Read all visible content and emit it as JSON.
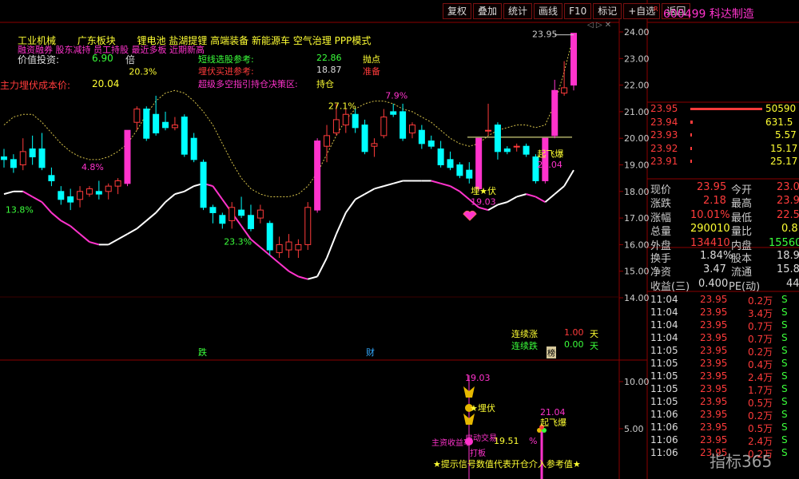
{
  "toolbar": {
    "buttons": [
      "复权",
      "叠加",
      "统计",
      "画线",
      "F10",
      "标记",
      "+自选",
      "返回"
    ],
    "icons": "◁ ▷ ✕"
  },
  "stock": {
    "badge": "R",
    "code_name": "600499 科达制造"
  },
  "overlay": {
    "sectors": [
      "工业机械",
      "广东板块",
      "锂电池",
      "盐湖提锂",
      "高端装备",
      "新能源车",
      "空气治理",
      "PPP模式"
    ],
    "line2": "融资融券  股东减持  员工持股  最近多板  近期新高",
    "value_label": "价值投资:",
    "value": "6.90",
    "value_unit": "倍",
    "cost_label": "主力埋伏成本价:",
    "cost": "20.04",
    "short_label": "短线选股参考:",
    "short_val": "22.86",
    "short_sig": "抛点",
    "ambush_label": "埋伏买进参考:",
    "ambush_val": "18.87",
    "ambush_sig": "准备",
    "super_label": "超级多空指引持仓决策区:",
    "super_sig": "持仓",
    "streak_up_label": "连续涨",
    "streak_up_val": "1.00",
    "streak_up_unit": "天",
    "streak_dn_label": "连续跌",
    "streak_dn_val": "0.00",
    "streak_dn_unit": "天",
    "markers": {
      "die": "跌",
      "cai": "财",
      "bang": "榜"
    }
  },
  "sub": {
    "price_top": "19.03",
    "maifu": "★埋伏",
    "jidong": "启动交易",
    "zhuli": "主资收益率",
    "pct_val": "19.51",
    "pct_sign": "%",
    "daban": "打板",
    "tip": "★提示信号数值代表开仓介入参考值★",
    "qifei_val": "21.04",
    "qifei": "起飞爆"
  },
  "orderbook": [
    {
      "price": "23.95",
      "vol": "50590",
      "bar": 1.0
    },
    {
      "price": "23.94",
      "vol": "631.5",
      "bar": 0.0
    },
    {
      "price": "23.93",
      "vol": "5.57",
      "bar": 0.0
    },
    {
      "price": "23.92",
      "vol": "15.17",
      "bar": 0.0
    },
    {
      "price": "23.91",
      "vol": "25.17",
      "bar": 0.0
    }
  ],
  "info": [
    [
      "现价",
      "23.95",
      "今开",
      "23.0"
    ],
    [
      "涨跌",
      "2.18",
      "最高",
      "23.9"
    ],
    [
      "涨幅",
      "10.01%",
      "最低",
      "22.5"
    ],
    [
      "总量",
      "290010",
      "量比",
      "0.8"
    ],
    [
      "外盘",
      "134410",
      "内盘",
      "15560"
    ]
  ],
  "fin": [
    [
      "换手",
      "1.84%",
      "股本",
      "18.9"
    ],
    [
      "净资",
      "3.47",
      "流通",
      "15.8"
    ],
    [
      "收益(三)",
      "0.400",
      "PE(动)",
      "44"
    ]
  ],
  "trades": [
    [
      "11:04",
      "23.95",
      "0.2万",
      "S"
    ],
    [
      "11:04",
      "23.95",
      "3.4万",
      "S"
    ],
    [
      "11:04",
      "23.95",
      "0.7万",
      "S"
    ],
    [
      "11:04",
      "23.95",
      "0.7万",
      "S"
    ],
    [
      "11:05",
      "23.95",
      "0.2万",
      "S"
    ],
    [
      "11:05",
      "23.95",
      "0.4万",
      "S"
    ],
    [
      "11:05",
      "23.95",
      "2.4万",
      "S"
    ],
    [
      "11:05",
      "23.95",
      "1.7万",
      "S"
    ],
    [
      "11:05",
      "23.95",
      "0.5万",
      "S"
    ],
    [
      "11:06",
      "23.95",
      "0.2万",
      "S"
    ],
    [
      "11:06",
      "23.95",
      "0.5万",
      "S"
    ],
    [
      "11:06",
      "23.95",
      "2.4万",
      "S"
    ],
    [
      "11:06",
      "23.95",
      "0.2万",
      "S"
    ]
  ],
  "watermark": "指标365",
  "colors": {
    "up": "#ff3b3b",
    "down": "#00ffff",
    "limit": "#ff33cc",
    "bg": "#000000"
  },
  "chart_data": {
    "type": "candlestick",
    "ylim": [
      13.6,
      24.5
    ],
    "yticks": [
      "24.00",
      "23.00",
      "22.00",
      "21.00",
      "20.00",
      "19.00",
      "18.00",
      "17.00",
      "16.00",
      "15.00",
      "14.00"
    ],
    "sub_yticks": [
      "10.00",
      "5.00"
    ],
    "last_price_label": "23.95",
    "reference_price": 20.04,
    "candles": [
      {
        "o": 19.3,
        "h": 19.6,
        "l": 18.9,
        "c": 19.2
      },
      {
        "o": 19.2,
        "h": 19.4,
        "l": 18.7,
        "c": 18.9
      },
      {
        "o": 19.0,
        "h": 20.0,
        "l": 18.8,
        "c": 19.5
      },
      {
        "o": 19.6,
        "h": 20.1,
        "l": 19.0,
        "c": 19.3
      },
      {
        "o": 19.6,
        "h": 20.2,
        "l": 18.8,
        "c": 18.9
      },
      {
        "o": 18.6,
        "h": 18.9,
        "l": 18.2,
        "c": 18.4
      },
      {
        "o": 18.0,
        "h": 18.2,
        "l": 17.5,
        "c": 17.7
      },
      {
        "o": 17.8,
        "h": 18.1,
        "l": 17.3,
        "c": 17.6
      },
      {
        "o": 17.7,
        "h": 18.2,
        "l": 17.4,
        "c": 18.0
      },
      {
        "o": 17.9,
        "h": 18.2,
        "l": 17.8,
        "c": 18.1
      },
      {
        "o": 18.0,
        "h": 18.4,
        "l": 17.7,
        "c": 17.9
      },
      {
        "o": 18.0,
        "h": 18.3,
        "l": 17.7,
        "c": 18.2
      },
      {
        "o": 18.2,
        "h": 18.5,
        "l": 17.9,
        "c": 18.4
      },
      {
        "o": 18.3,
        "h": 20.3,
        "l": 18.2,
        "c": 20.3
      },
      {
        "o": 20.6,
        "h": 21.2,
        "l": 20.3,
        "c": 21.1
      },
      {
        "o": 21.1,
        "h": 21.2,
        "l": 19.9,
        "c": 20.0
      },
      {
        "o": 20.9,
        "h": 21.6,
        "l": 20.1,
        "c": 20.2
      },
      {
        "o": 20.6,
        "h": 21.0,
        "l": 20.3,
        "c": 20.4
      },
      {
        "o": 20.4,
        "h": 20.8,
        "l": 20.3,
        "c": 20.5
      },
      {
        "o": 20.8,
        "h": 20.9,
        "l": 19.3,
        "c": 19.4
      },
      {
        "o": 20.0,
        "h": 20.2,
        "l": 19.1,
        "c": 19.2
      },
      {
        "o": 19.1,
        "h": 19.2,
        "l": 17.3,
        "c": 17.4
      },
      {
        "o": 17.4,
        "h": 17.5,
        "l": 16.8,
        "c": 17.2
      },
      {
        "o": 17.1,
        "h": 17.2,
        "l": 16.6,
        "c": 16.8
      },
      {
        "o": 16.9,
        "h": 17.6,
        "l": 16.6,
        "c": 17.4
      },
      {
        "o": 17.3,
        "h": 17.8,
        "l": 17.0,
        "c": 17.1
      },
      {
        "o": 17.1,
        "h": 17.5,
        "l": 16.5,
        "c": 16.6
      },
      {
        "o": 17.0,
        "h": 17.5,
        "l": 16.8,
        "c": 17.3
      },
      {
        "o": 16.8,
        "h": 16.9,
        "l": 15.6,
        "c": 15.8
      },
      {
        "o": 15.7,
        "h": 16.3,
        "l": 15.5,
        "c": 16.0
      },
      {
        "o": 15.8,
        "h": 16.4,
        "l": 15.5,
        "c": 16.1
      },
      {
        "o": 15.8,
        "h": 16.2,
        "l": 15.5,
        "c": 16.0
      },
      {
        "o": 16.0,
        "h": 17.6,
        "l": 15.8,
        "c": 17.4
      },
      {
        "o": 17.3,
        "h": 20.0,
        "l": 17.2,
        "c": 19.9
      },
      {
        "o": 19.7,
        "h": 20.5,
        "l": 19.1,
        "c": 20.1
      },
      {
        "o": 20.2,
        "h": 21.3,
        "l": 20.1,
        "c": 20.7
      },
      {
        "o": 20.5,
        "h": 21.1,
        "l": 20.2,
        "c": 20.9
      },
      {
        "o": 20.9,
        "h": 21.1,
        "l": 20.2,
        "c": 20.4
      },
      {
        "o": 20.5,
        "h": 20.7,
        "l": 19.4,
        "c": 19.5
      },
      {
        "o": 19.7,
        "h": 20.0,
        "l": 19.3,
        "c": 19.8
      },
      {
        "o": 20.1,
        "h": 21.1,
        "l": 20.0,
        "c": 20.8
      },
      {
        "o": 21.0,
        "h": 21.3,
        "l": 20.8,
        "c": 20.9
      },
      {
        "o": 21.0,
        "h": 21.3,
        "l": 19.9,
        "c": 20.0
      },
      {
        "o": 20.2,
        "h": 20.6,
        "l": 20.0,
        "c": 20.5
      },
      {
        "o": 20.3,
        "h": 20.5,
        "l": 19.6,
        "c": 19.8
      },
      {
        "o": 19.9,
        "h": 20.1,
        "l": 19.6,
        "c": 19.7
      },
      {
        "o": 19.6,
        "h": 19.9,
        "l": 18.9,
        "c": 19.0
      },
      {
        "o": 19.2,
        "h": 19.5,
        "l": 18.8,
        "c": 18.9
      },
      {
        "o": 19.0,
        "h": 19.1,
        "l": 18.5,
        "c": 18.6
      },
      {
        "o": 18.8,
        "h": 19.1,
        "l": 18.3,
        "c": 18.5
      },
      {
        "o": 18.1,
        "h": 20.0,
        "l": 18.0,
        "c": 20.0
      },
      {
        "o": 20.3,
        "h": 21.3,
        "l": 20.1,
        "c": 20.3
      },
      {
        "o": 20.5,
        "h": 20.6,
        "l": 19.2,
        "c": 19.5
      },
      {
        "o": 19.6,
        "h": 19.7,
        "l": 19.4,
        "c": 19.5
      },
      {
        "o": 19.7,
        "h": 19.8,
        "l": 19.5,
        "c": 19.7
      },
      {
        "o": 19.7,
        "h": 19.8,
        "l": 19.3,
        "c": 19.4
      },
      {
        "o": 19.3,
        "h": 19.4,
        "l": 18.3,
        "c": 18.4
      },
      {
        "o": 18.4,
        "h": 20.0,
        "l": 18.3,
        "c": 20.0
      },
      {
        "o": 20.1,
        "h": 22.2,
        "l": 20.0,
        "c": 21.8
      },
      {
        "o": 21.7,
        "h": 22.9,
        "l": 21.6,
        "c": 21.9
      },
      {
        "o": 22.0,
        "h": 23.9,
        "l": 21.8,
        "c": 23.95
      }
    ],
    "lower_band": [
      17.9,
      18.0,
      18.0,
      17.8,
      17.6,
      17.2,
      16.9,
      16.7,
      16.4,
      16.1,
      16.0,
      16.0,
      16.2,
      16.4,
      16.6,
      16.9,
      17.2,
      17.6,
      17.9,
      18.0,
      18.2,
      18.3,
      18.2,
      17.7,
      17.2,
      16.7,
      16.2,
      15.9,
      15.6,
      15.3,
      15.0,
      14.8,
      14.7,
      14.8,
      15.5,
      16.4,
      17.2,
      17.7,
      17.9,
      18.1,
      18.2,
      18.3,
      18.4,
      18.4,
      18.4,
      18.4,
      18.3,
      18.2,
      18.0,
      17.7,
      17.4,
      17.3,
      17.5,
      17.6,
      17.8,
      17.9,
      17.8,
      17.6,
      17.9,
      18.2,
      18.8
    ],
    "upper_band": [
      20.5,
      20.8,
      20.9,
      20.9,
      20.6,
      20.2,
      19.8,
      19.5,
      19.3,
      19.2,
      19.2,
      19.3,
      19.5,
      19.8,
      20.3,
      20.9,
      21.4,
      21.7,
      21.8,
      21.7,
      21.4,
      21.0,
      20.5,
      19.8,
      19.1,
      18.5,
      18.1,
      17.9,
      17.8,
      17.8,
      17.8,
      17.9,
      18.2,
      18.7,
      19.4,
      20.1,
      20.7,
      21.1,
      21.3,
      21.4,
      21.4,
      21.3,
      21.1,
      21.0,
      20.8,
      20.6,
      20.3,
      20.0,
      19.8,
      19.7,
      19.8,
      20.1,
      20.3,
      20.4,
      20.5,
      20.5,
      20.4,
      20.5,
      21.3,
      22.5,
      23.9
    ],
    "annotations": [
      {
        "i": 1,
        "price": 17.2,
        "text": "13.8%"
      },
      {
        "i": 9,
        "price": 18.8,
        "text": "4.8%"
      },
      {
        "i": 14,
        "price": 22.4,
        "text": "20.3%"
      },
      {
        "i": 24,
        "price": 16.0,
        "text": "23.3%"
      },
      {
        "i": 35,
        "price": 21.1,
        "text": "27.1%"
      },
      {
        "i": 41,
        "price": 21.5,
        "text": "7.9%"
      },
      {
        "i": 50,
        "price": 17.9,
        "text": "埋★伏"
      },
      {
        "i": 50,
        "price": 17.5,
        "text": "19.03"
      },
      {
        "i": 57,
        "price": 19.3,
        "text": "起飞爆"
      },
      {
        "i": 57,
        "price": 18.9,
        "text": "21.04"
      }
    ]
  }
}
